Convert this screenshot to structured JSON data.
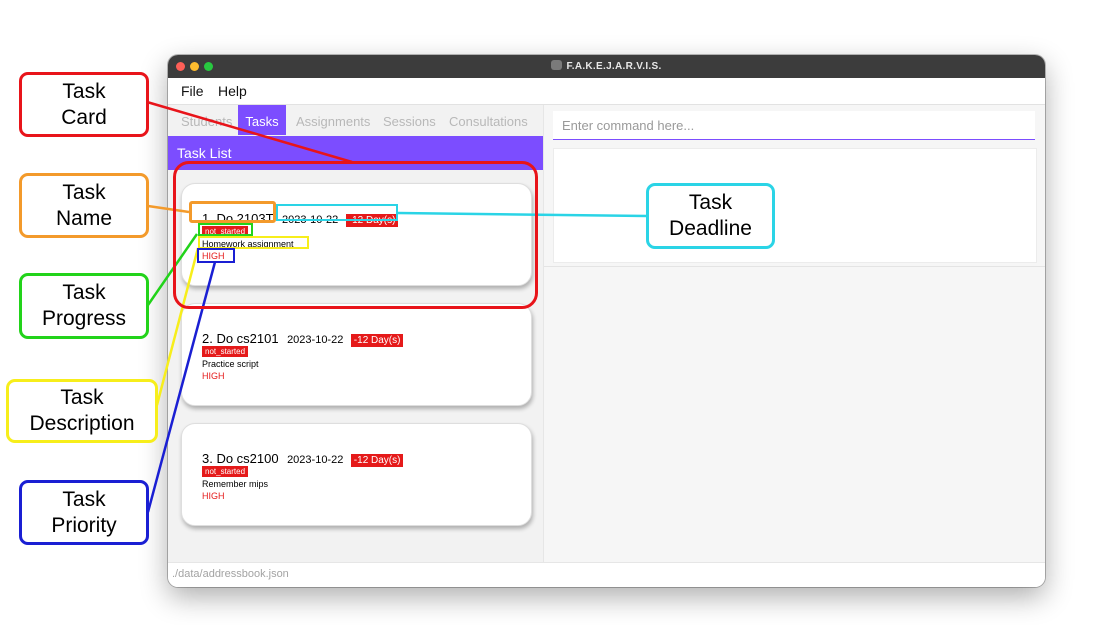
{
  "window": {
    "title": "F.A.K.E.J.A.R.V.I.S."
  },
  "menu": {
    "file": "File",
    "help": "Help"
  },
  "tabs": {
    "students": "Students",
    "tasks": "Tasks",
    "assignments": "Assignments",
    "sessions": "Sessions",
    "consultations": "Consultations",
    "active": "Tasks"
  },
  "task_list": {
    "header": "Task List",
    "cards": [
      {
        "name": "1.  Do 2103T",
        "deadline": "2023-10-22",
        "days": "-12 Day(s)",
        "progress": "not_started",
        "description": "Homework assignment",
        "priority": "HIGH"
      },
      {
        "name": "2.  Do cs2101",
        "deadline": "2023-10-22",
        "days": "-12 Day(s)",
        "progress": "not_started",
        "description": "Practice script",
        "priority": "HIGH"
      },
      {
        "name": "3.  Do cs2100",
        "deadline": "2023-10-22",
        "days": "-12 Day(s)",
        "progress": "not_started",
        "description": "Remember mips",
        "priority": "HIGH"
      }
    ]
  },
  "command": {
    "placeholder": "Enter command here...",
    "value": ""
  },
  "status": {
    "path": "./data/addressbook.json"
  },
  "annotations": {
    "task_card": "Task\nCard",
    "task_name": "Task\nName",
    "task_progress": "Task\nProgress",
    "task_description": "Task\nDescription",
    "task_priority": "Task\nPriority",
    "task_deadline": "Task\nDeadline"
  },
  "colors": {
    "accent": "#7c4dff",
    "overdue": "#e51a1a",
    "card_callout": "#e8141a",
    "name_callout": "#f39a2b",
    "progress_callout": "#22d31a",
    "description_callout": "#f7ee1b",
    "priority_callout": "#1a1fd3",
    "deadline_callout": "#2ad4e6"
  }
}
